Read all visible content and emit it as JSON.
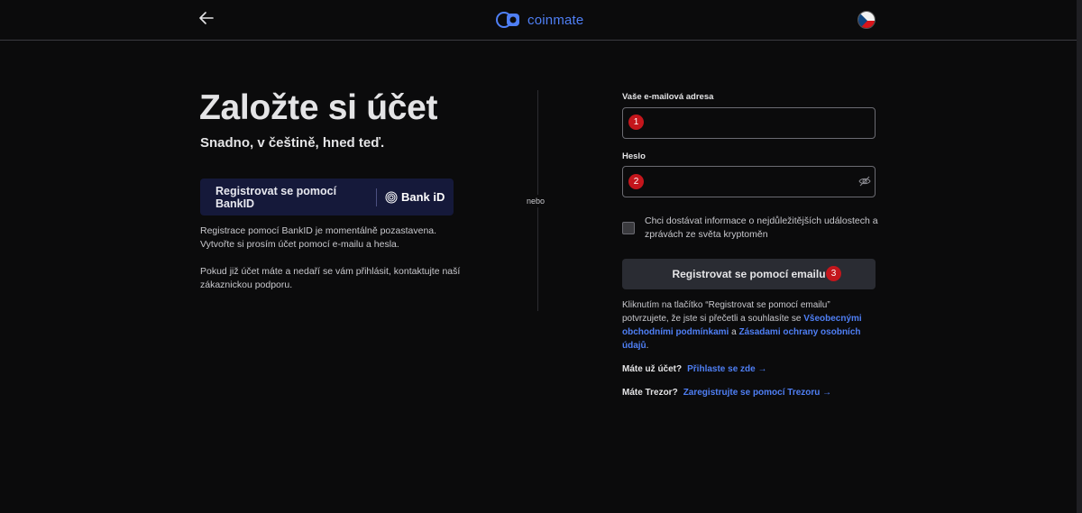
{
  "header": {
    "brand": "coinmate",
    "brand_color": "#4f7ff5",
    "back_icon": "arrow-left-icon",
    "language_icon": "czech-flag-icon"
  },
  "left": {
    "title": "Založte si účet",
    "subtitle": "Snadno, v češtině, hned teď.",
    "bankid_button_label": "Registrovat se pomocí BankID",
    "bankid_logo_text": "Bank iD",
    "note_1": "Registrace pomocí BankID je momentálně pozastavena. Vytvořte si prosím účet pomocí e-mailu a hesla.",
    "note_2": "Pokud již účet máte a nedaří se vám přihlásit, kontaktujte naší zákaznickou podporu."
  },
  "divider_label": "nebo",
  "form": {
    "email_label": "Vaše e-mailová adresa",
    "email_value": "",
    "password_label": "Heslo",
    "password_value": "",
    "badge_1": "1",
    "badge_2": "2",
    "badge_3": "3",
    "newsletter_text": "Chci dostávat informace o nejdůležitějších událostech a zprávách ze světa kryptoměn",
    "newsletter_checked": false,
    "submit_label": "Registrovat se pomocí emailu",
    "consent_prefix": "Kliknutím na tlačítko “Registrovat se pomocí emailu” potvrzujete, že jste si přečetli a souhlasíte se ",
    "consent_link_1": "Všeobecnými obchodními podmínkami",
    "consent_middle": " a ",
    "consent_link_2": "Zásadami ochrany osobních údajů",
    "consent_suffix": ".",
    "login_question": "Máte už účet?",
    "login_link": "Přihlaste se zde →",
    "trezor_question": "Máte Trezor?",
    "trezor_link": "Zaregistrujte se pomocí Trezoru →"
  },
  "colors": {
    "background": "#0b0b0c",
    "badge": "#c4161c",
    "bankid_button": "#15193a",
    "link": "#4f7ff5"
  }
}
